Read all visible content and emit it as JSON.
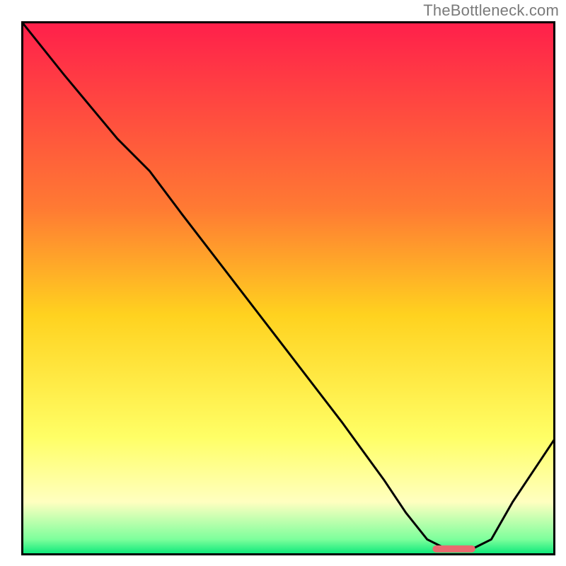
{
  "watermark": "TheBottleneck.com",
  "chart_data": {
    "type": "line",
    "title": "",
    "xlabel": "",
    "ylabel": "",
    "xlim": [
      0,
      100
    ],
    "ylim": [
      0,
      100
    ],
    "gradient_stops": [
      {
        "offset": 0,
        "color": "#ff1f4b"
      },
      {
        "offset": 35,
        "color": "#ff7a33"
      },
      {
        "offset": 55,
        "color": "#ffd21f"
      },
      {
        "offset": 78,
        "color": "#ffff66"
      },
      {
        "offset": 90,
        "color": "#ffffc0"
      },
      {
        "offset": 97,
        "color": "#7dff9c"
      },
      {
        "offset": 100,
        "color": "#00e676"
      }
    ],
    "series": [
      {
        "name": "bottleneck-curve",
        "x": [
          0,
          8,
          18,
          24,
          30,
          40,
          50,
          60,
          68,
          72,
          76,
          80,
          84,
          88,
          92,
          96,
          100
        ],
        "y": [
          100,
          90,
          78,
          72,
          64,
          51,
          38,
          25,
          14,
          8,
          3,
          1,
          1,
          3,
          10,
          16,
          22
        ]
      }
    ],
    "marker": {
      "name": "optimal-range",
      "x_start": 77,
      "x_end": 85,
      "y": 1.2,
      "color": "#e86a6f"
    }
  }
}
